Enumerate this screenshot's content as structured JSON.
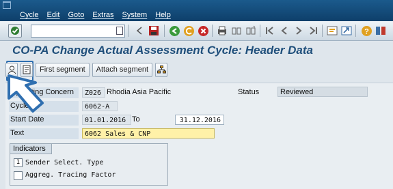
{
  "menu": {
    "items": [
      "Cycle",
      "Edit",
      "Goto",
      "Extras",
      "System",
      "Help"
    ]
  },
  "toolbar": {
    "command_value": "",
    "icons": [
      "enter-icon",
      "back-icon",
      "save-icon",
      "exit-icon",
      "cancel-icon",
      "print-icon",
      "find-icon",
      "find-next-icon",
      "first-page-icon",
      "prev-page-icon",
      "next-page-icon",
      "last-page-icon",
      "new-session-icon",
      "shortcut-icon",
      "help-icon",
      "customize-layout-icon"
    ]
  },
  "page": {
    "title": "CO-PA Change Actual Assessment Cycle: Header Data"
  },
  "app_toolbar": {
    "first_segment": "First segment",
    "attach_segment": "Attach segment"
  },
  "form": {
    "operating_concern": {
      "label": "Operating Concern",
      "code": "Z026",
      "desc": "Rhodia Asia Pacific"
    },
    "cycle": {
      "label": "Cycle",
      "value": "6062-A"
    },
    "start_date": {
      "label": "Start Date",
      "value": "01.01.2016",
      "to_label": "To",
      "to_value": "31.12.2016"
    },
    "text": {
      "label": "Text",
      "value": "6062 Sales & CNP"
    },
    "status": {
      "label": "Status",
      "value": "Reviewed"
    }
  },
  "indicators": {
    "title": "Indicators",
    "sender_select_value": "1",
    "sender_select_label": "Sender Select. Type",
    "aggreg_label": "Aggreg. Tracing Factor",
    "aggreg_checked": false
  }
}
